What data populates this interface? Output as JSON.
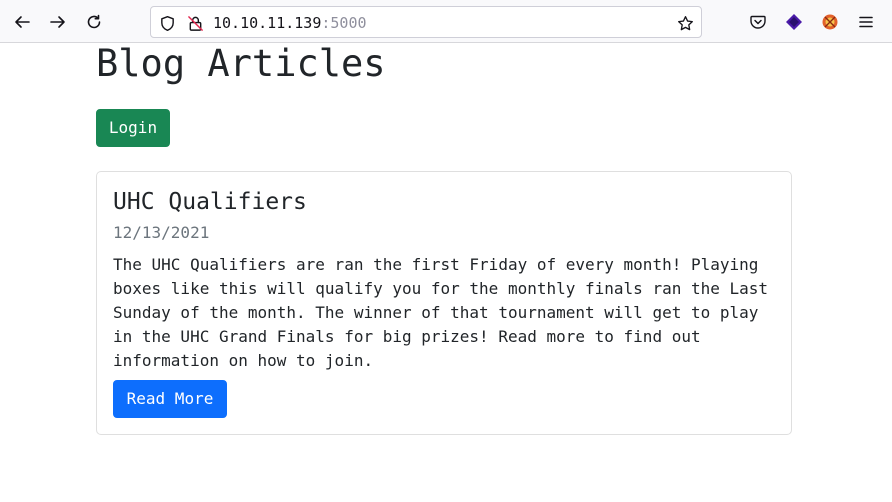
{
  "browser": {
    "url_host": "10.10.11.139",
    "url_port": ":5000",
    "icons": {
      "back": "back-arrow-icon",
      "forward": "forward-arrow-icon",
      "reload": "reload-icon",
      "shield": "shield-icon",
      "insecure": "insecure-lock-icon",
      "bookmark": "bookmark-star-icon",
      "pocket": "pocket-icon",
      "extension1": "extension-icon",
      "extension2": "extension-icon",
      "menu": "hamburger-menu-icon"
    },
    "colors": {
      "extension1": "#4a1aa8",
      "extension2": "#e2602a"
    }
  },
  "page": {
    "title": "Blog Articles",
    "login_label": "Login"
  },
  "articles": [
    {
      "title": "UHC Qualifiers",
      "date": "12/13/2021",
      "body": "The UHC Qualifiers are ran the first Friday of every month! Playing boxes like this will qualify you for the monthly finals ran the Last Sunday of the month. The winner of that tournament will get to play in the UHC Grand Finals for big prizes! Read more to find out information on how to join.",
      "button_label": "Read More"
    }
  ],
  "colors": {
    "login_button": "#198754",
    "read_more_button": "#0d6efd",
    "date_text": "#6c757d"
  }
}
